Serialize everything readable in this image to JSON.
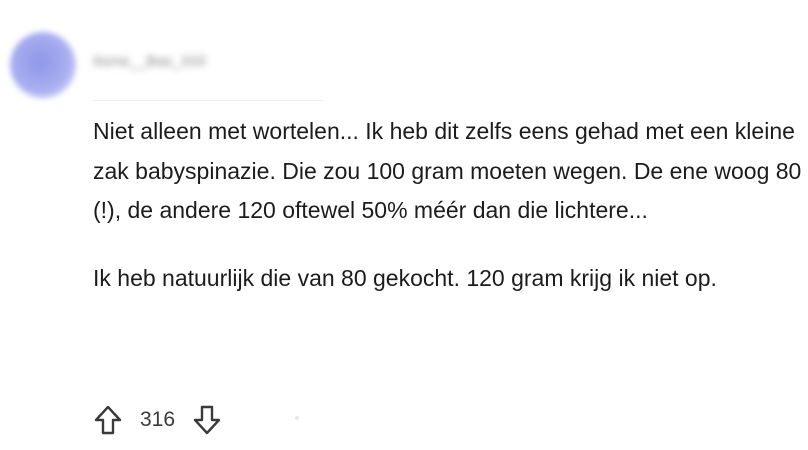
{
  "comment": {
    "username": "Itsme__Bas_333",
    "paragraphs": [
      "Niet alleen met wortelen... Ik heb dit zelfs eens gehad met een kleine zak babyspinazie. Die zou 100 gram moeten wegen. De ene woog 80 (!), de andere 120 oftewel 50% méér dan die lichtere...",
      "Ik heb natuurlijk die van 80 gekocht. 120 gram krijg ik niet op."
    ],
    "score": "316"
  },
  "icons": {
    "upvote": "arrow-up-outline-icon",
    "downvote": "arrow-down-outline-icon"
  },
  "colors": {
    "text": "#1c1c1c",
    "meta": "#3a3a3a",
    "avatar": "#8f96e8"
  }
}
